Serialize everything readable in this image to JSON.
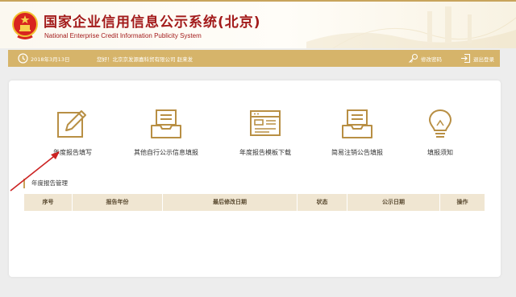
{
  "header": {
    "title": "国家企业信用信息公示系统(北京)",
    "subtitle": "National Enterprise Credit Information Publicity System"
  },
  "infobar": {
    "date": "2018年3月13日",
    "greeting": "您好！北京京发源嘉科贸有限公司 赵来发",
    "change_password": "修改密码",
    "logout": "退出登录"
  },
  "tools": [
    {
      "label": "年度报告填写",
      "icon": "edit-report-icon"
    },
    {
      "label": "其他自行公示信息填报",
      "icon": "inbox-tray-icon"
    },
    {
      "label": "年度报告模板下载",
      "icon": "template-window-icon"
    },
    {
      "label": "简易注销公告填报",
      "icon": "inbox-tray-icon"
    },
    {
      "label": "填报须知",
      "icon": "lightbulb-icon"
    }
  ],
  "section": {
    "title": "年度报告管理"
  },
  "table": {
    "columns": [
      "序号",
      "报告年份",
      "最后修改日期",
      "状态",
      "公示日期",
      "操作"
    ]
  },
  "colors": {
    "accent": "#d6b46a",
    "title_red": "#a31b1b",
    "icon_gold": "#b88f44",
    "table_header": "#f0e6d2",
    "annotation_arrow": "#cc2222"
  }
}
